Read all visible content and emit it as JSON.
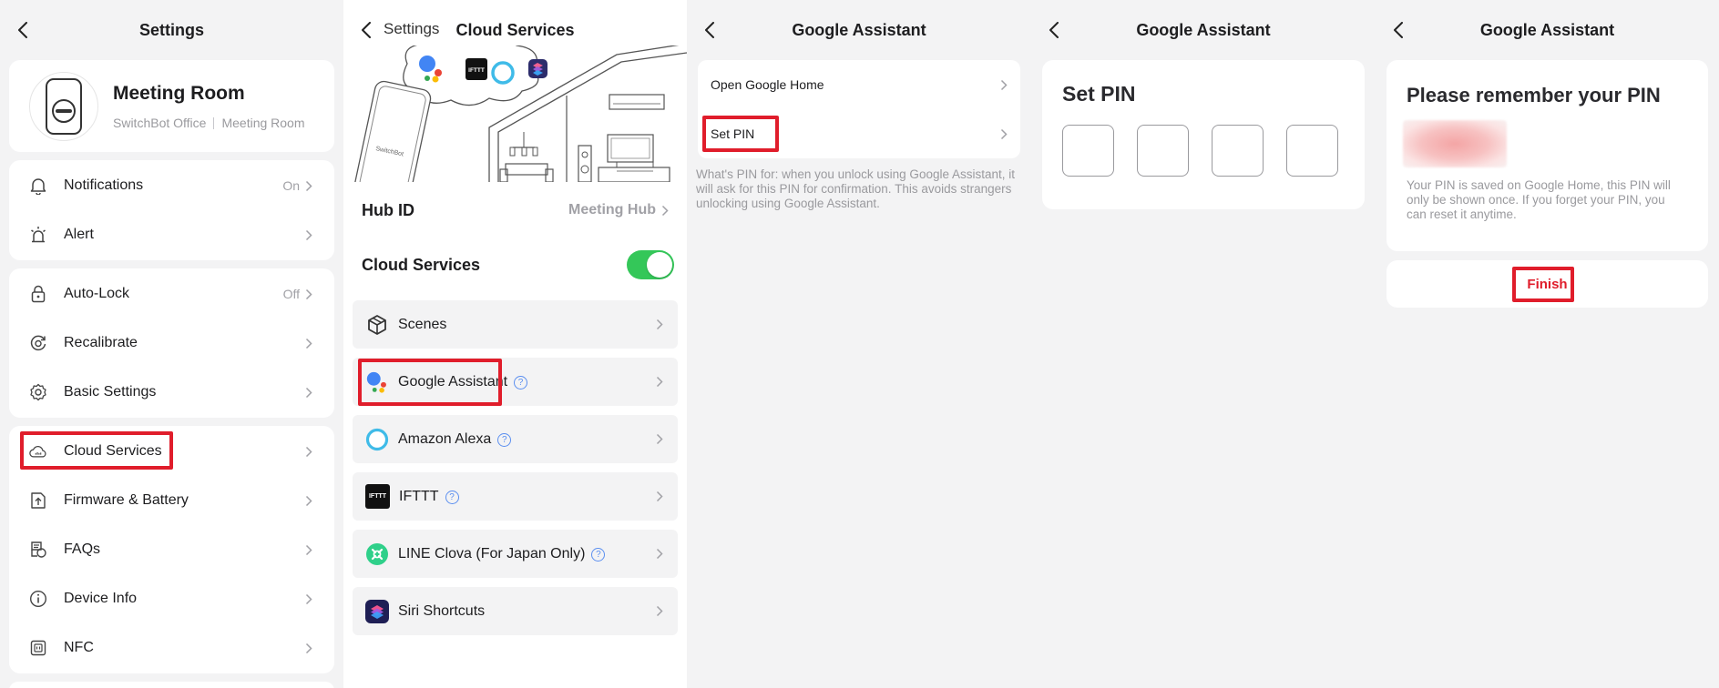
{
  "screen1": {
    "title": "Settings",
    "device": {
      "name": "Meeting Room",
      "home": "SwitchBot Office",
      "room": "Meeting Room"
    },
    "group1": [
      {
        "label": "Notifications",
        "value": "On",
        "icon": "bell-icon"
      },
      {
        "label": "Alert",
        "value": "",
        "icon": "siren-icon"
      }
    ],
    "group2": [
      {
        "label": "Auto-Lock",
        "value": "Off",
        "icon": "lock-icon"
      },
      {
        "label": "Recalibrate",
        "value": "",
        "icon": "recalibrate-icon"
      },
      {
        "label": "Basic Settings",
        "value": "",
        "icon": "gear-icon"
      }
    ],
    "group3": [
      {
        "label": "Cloud Services",
        "value": "",
        "icon": "cloud-icon"
      },
      {
        "label": "Firmware & Battery",
        "value": "",
        "icon": "firmware-icon"
      },
      {
        "label": "FAQs",
        "value": "",
        "icon": "faq-icon"
      },
      {
        "label": "Device Info",
        "value": "",
        "icon": "info-icon"
      },
      {
        "label": "NFC",
        "value": "",
        "icon": "nfc-icon"
      }
    ]
  },
  "screen2": {
    "back_label": "Settings",
    "title": "Cloud Services",
    "hero_phone_text": "SwitchBot",
    "hero_ifttt_text": "IFTTT",
    "hub_label": "Hub ID",
    "hub_value": "Meeting Hub",
    "cloud_label": "Cloud Services",
    "cloud_enabled": true,
    "services": [
      {
        "label": "Scenes",
        "help": false,
        "icon": "scenes-icon"
      },
      {
        "label": "Google Assistant",
        "help": true,
        "icon": "google-assistant-icon"
      },
      {
        "label": "Amazon Alexa",
        "help": true,
        "icon": "alexa-icon"
      },
      {
        "label": "IFTTT",
        "help": true,
        "icon": "ifttt-icon",
        "icon_text": "IFTTT"
      },
      {
        "label": "LINE Clova (For Japan Only)",
        "help": true,
        "icon": "clova-icon"
      },
      {
        "label": "Siri Shortcuts",
        "help": false,
        "icon": "siri-shortcuts-icon"
      }
    ]
  },
  "screen3": {
    "title": "Google Assistant",
    "rows": [
      {
        "label": "Open Google Home"
      },
      {
        "label": "Set PIN"
      }
    ],
    "note": "What's PIN for: when you unlock using Google Assistant, it will ask for this PIN for confirmation. This avoids strangers unlocking using Google Assistant."
  },
  "screen4": {
    "title": "Google Assistant",
    "card_title": "Set PIN"
  },
  "screen5": {
    "title": "Google Assistant",
    "card_title": "Please remember your PIN",
    "note": "Your PIN is saved on Google Home, this PIN will only be shown once. If you forget your PIN, you can reset it anytime.",
    "finish_label": "Finish"
  },
  "colors": {
    "highlight": "#e01d2b",
    "toggle_on": "#34c759",
    "help_blue": "#5b8ff0"
  }
}
